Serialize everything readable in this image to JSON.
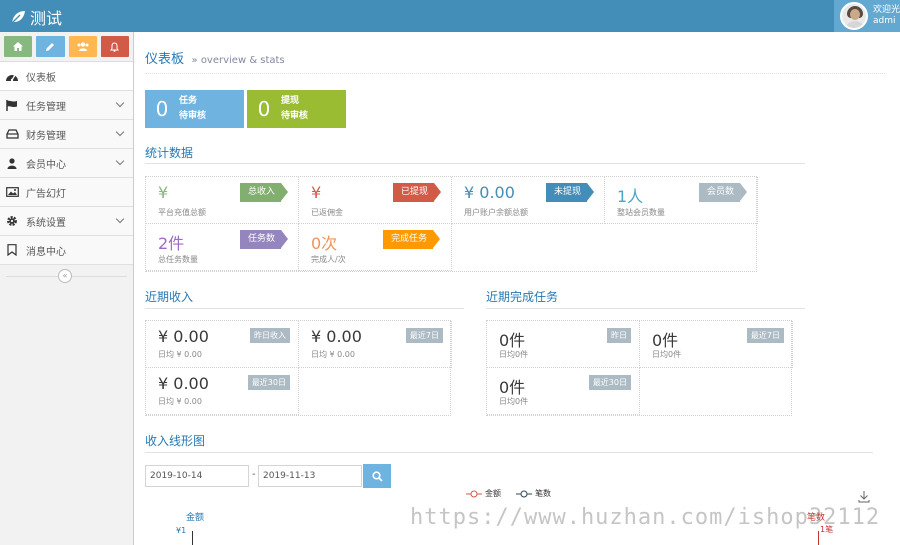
{
  "app": {
    "title": "测试"
  },
  "user": {
    "greeting": "欢迎光",
    "name": "admi"
  },
  "sidebar": {
    "items": [
      {
        "label": "仪表板"
      },
      {
        "label": "任务管理"
      },
      {
        "label": "财务管理"
      },
      {
        "label": "会员中心"
      },
      {
        "label": "广告幻灯"
      },
      {
        "label": "系统设置"
      },
      {
        "label": "消息中心"
      }
    ],
    "collapse_symbol": "«"
  },
  "header": {
    "title": "仪表板",
    "subtitle": "» overview & stats"
  },
  "infoboxes": [
    {
      "value": "0",
      "line1": "任务",
      "line2": "待审核",
      "color": "#6fb3e0"
    },
    {
      "value": "0",
      "line1": "提现",
      "line2": "待审核",
      "color": "#9abc32"
    }
  ],
  "stats": {
    "title": "统计数据",
    "cells": [
      {
        "value": "¥",
        "desc": "平台充值总额",
        "tag": "总收入",
        "color": "#87b87f"
      },
      {
        "value": "¥",
        "desc": "已返佣金",
        "tag": "已提现",
        "color": "#d15b47"
      },
      {
        "value": "¥ 0.00",
        "desc": "用户账户余额总额",
        "tag": "未提现",
        "color": "#438eb9"
      },
      {
        "value": "1人",
        "desc": "整站会员数量",
        "tag": "会员数",
        "color": "#4aa4ce"
      },
      {
        "value": "2件",
        "desc": "总任务数量",
        "tag": "任务数",
        "color": "#a069c3"
      },
      {
        "value": "0次",
        "desc": "完成人/次",
        "tag": "完成任务",
        "color": "#f0935a"
      }
    ]
  },
  "income": {
    "title": "近期收入",
    "cells": [
      {
        "value": "¥ 0.00",
        "desc": "日均 ¥ 0.00",
        "tag": "昨日收入"
      },
      {
        "value": "¥ 0.00",
        "desc": "日均 ¥ 0.00",
        "tag": "最近7日"
      },
      {
        "value": "¥ 0.00",
        "desc": "日均 ¥ 0.00",
        "tag": "最近30日"
      }
    ]
  },
  "tasks": {
    "title": "近期完成任务",
    "cells": [
      {
        "value": "0件",
        "desc": "日均0件",
        "tag": "昨日"
      },
      {
        "value": "0件",
        "desc": "日均0件",
        "tag": "最近7日"
      },
      {
        "value": "0件",
        "desc": "日均0件",
        "tag": "最近30日"
      }
    ]
  },
  "chart": {
    "title": "收入线形图",
    "start_date": "2019-10-14",
    "end_date": "2019-11-13",
    "separator": "-",
    "legend": [
      "金额",
      "笔数"
    ],
    "axis_name": "金额",
    "first_tick": "¥1",
    "right_tick": "1笔",
    "right_label": "笔数"
  },
  "watermark": "https://www.huzhan.com/ishop32112"
}
